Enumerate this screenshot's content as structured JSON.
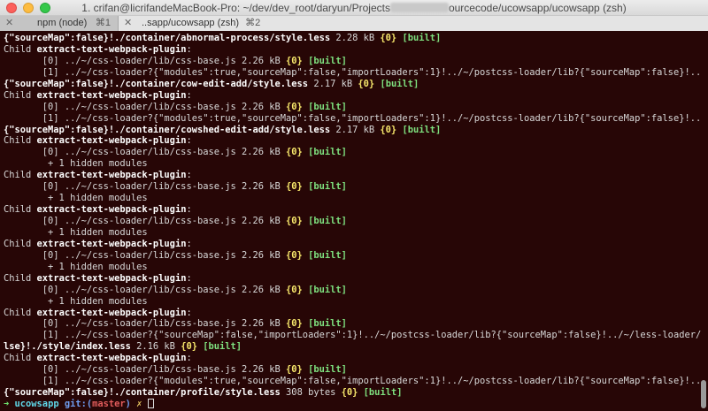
{
  "window": {
    "title_prefix": "1. crifan@licrifandeMacBook-Pro: ~/dev/dev_root/daryun/Projects",
    "title_suffix": "ourcecode/ucowsapp/ucowsapp (zsh)"
  },
  "tabs": [
    {
      "close": "✕",
      "label": "npm (node)",
      "shortcut": "⌘1"
    },
    {
      "close": "✕",
      "label": "..sapp/ucowsapp (zsh)",
      "shortcut": "⌘2"
    }
  ],
  "terminal": {
    "lines": [
      [
        [
          "b",
          "{\"sourceMap\":false}!./container/abnormal-process/style.less"
        ],
        [
          "d",
          " 2.28 kB "
        ],
        [
          "y",
          "{0}"
        ],
        [
          "d",
          " "
        ],
        [
          "g",
          "[built]"
        ]
      ],
      [
        [
          "d",
          "Child "
        ],
        [
          "b",
          "extract-text-webpack-plugin"
        ],
        [
          "d",
          ":"
        ]
      ],
      [
        [
          "d",
          "       [0] ../~/css-loader/lib/css-base.js 2.26 kB "
        ],
        [
          "y",
          "{0}"
        ],
        [
          "d",
          " "
        ],
        [
          "g",
          "[built]"
        ]
      ],
      [
        [
          "d",
          "       [1] ../~/css-loader?{\"modules\":true,\"sourceMap\":false,\"importLoaders\":1}!../~/postcss-loader/lib?{\"sourceMap\":false}!../~/less-loader/dist?"
        ]
      ],
      [
        [
          "b",
          "{\"sourceMap\":false}!./container/cow-edit-add/style.less"
        ],
        [
          "d",
          " 2.17 kB "
        ],
        [
          "y",
          "{0}"
        ],
        [
          "d",
          " "
        ],
        [
          "g",
          "[built]"
        ]
      ],
      [
        [
          "d",
          "Child "
        ],
        [
          "b",
          "extract-text-webpack-plugin"
        ],
        [
          "d",
          ":"
        ]
      ],
      [
        [
          "d",
          "       [0] ../~/css-loader/lib/css-base.js 2.26 kB "
        ],
        [
          "y",
          "{0}"
        ],
        [
          "d",
          " "
        ],
        [
          "g",
          "[built]"
        ]
      ],
      [
        [
          "d",
          "       [1] ../~/css-loader?{\"modules\":true,\"sourceMap\":false,\"importLoaders\":1}!../~/postcss-loader/lib?{\"sourceMap\":false}!../~/less-loader/dist?"
        ]
      ],
      [
        [
          "b",
          "{\"sourceMap\":false}!./container/cowshed-edit-add/style.less"
        ],
        [
          "d",
          " 2.17 kB "
        ],
        [
          "y",
          "{0}"
        ],
        [
          "d",
          " "
        ],
        [
          "g",
          "[built]"
        ]
      ],
      [
        [
          "d",
          "Child "
        ],
        [
          "b",
          "extract-text-webpack-plugin"
        ],
        [
          "d",
          ":"
        ]
      ],
      [
        [
          "d",
          "       [0] ../~/css-loader/lib/css-base.js 2.26 kB "
        ],
        [
          "y",
          "{0}"
        ],
        [
          "d",
          " "
        ],
        [
          "g",
          "[built]"
        ]
      ],
      [
        [
          "d",
          "        + 1 hidden modules"
        ]
      ],
      [
        [
          "d",
          "Child "
        ],
        [
          "b",
          "extract-text-webpack-plugin"
        ],
        [
          "d",
          ":"
        ]
      ],
      [
        [
          "d",
          "       [0] ../~/css-loader/lib/css-base.js 2.26 kB "
        ],
        [
          "y",
          "{0}"
        ],
        [
          "d",
          " "
        ],
        [
          "g",
          "[built]"
        ]
      ],
      [
        [
          "d",
          "        + 1 hidden modules"
        ]
      ],
      [
        [
          "d",
          "Child "
        ],
        [
          "b",
          "extract-text-webpack-plugin"
        ],
        [
          "d",
          ":"
        ]
      ],
      [
        [
          "d",
          "       [0] ../~/css-loader/lib/css-base.js 2.26 kB "
        ],
        [
          "y",
          "{0}"
        ],
        [
          "d",
          " "
        ],
        [
          "g",
          "[built]"
        ]
      ],
      [
        [
          "d",
          "        + 1 hidden modules"
        ]
      ],
      [
        [
          "d",
          "Child "
        ],
        [
          "b",
          "extract-text-webpack-plugin"
        ],
        [
          "d",
          ":"
        ]
      ],
      [
        [
          "d",
          "       [0] ../~/css-loader/lib/css-base.js 2.26 kB "
        ],
        [
          "y",
          "{0}"
        ],
        [
          "d",
          " "
        ],
        [
          "g",
          "[built]"
        ]
      ],
      [
        [
          "d",
          "        + 1 hidden modules"
        ]
      ],
      [
        [
          "d",
          "Child "
        ],
        [
          "b",
          "extract-text-webpack-plugin"
        ],
        [
          "d",
          ":"
        ]
      ],
      [
        [
          "d",
          "       [0] ../~/css-loader/lib/css-base.js 2.26 kB "
        ],
        [
          "y",
          "{0}"
        ],
        [
          "d",
          " "
        ],
        [
          "g",
          "[built]"
        ]
      ],
      [
        [
          "d",
          "        + 1 hidden modules"
        ]
      ],
      [
        [
          "d",
          "Child "
        ],
        [
          "b",
          "extract-text-webpack-plugin"
        ],
        [
          "d",
          ":"
        ]
      ],
      [
        [
          "d",
          "       [0] ../~/css-loader/lib/css-base.js 2.26 kB "
        ],
        [
          "y",
          "{0}"
        ],
        [
          "d",
          " "
        ],
        [
          "g",
          "[built]"
        ]
      ],
      [
        [
          "d",
          "       [1] ../~/css-loader?{\"sourceMap\":false,\"importLoaders\":1}!../~/postcss-loader/lib?{\"sourceMap\":false}!../~/less-loader/dist?{\"sourceMap\":fa"
        ]
      ],
      [
        [
          "b",
          "lse}!./style/index.less"
        ],
        [
          "d",
          " 2.16 kB "
        ],
        [
          "y",
          "{0}"
        ],
        [
          "d",
          " "
        ],
        [
          "g",
          "[built]"
        ]
      ],
      [
        [
          "d",
          "Child "
        ],
        [
          "b",
          "extract-text-webpack-plugin"
        ],
        [
          "d",
          ":"
        ]
      ],
      [
        [
          "d",
          "       [0] ../~/css-loader/lib/css-base.js 2.26 kB "
        ],
        [
          "y",
          "{0}"
        ],
        [
          "d",
          " "
        ],
        [
          "g",
          "[built]"
        ]
      ],
      [
        [
          "d",
          "       [1] ../~/css-loader?{\"modules\":true,\"sourceMap\":false,\"importLoaders\":1}!../~/postcss-loader/lib?{\"sourceMap\":false}!../~/less-loader/dist?"
        ]
      ],
      [
        [
          "b",
          "{\"sourceMap\":false}!./container/profile/style.less"
        ],
        [
          "d",
          " 308 bytes "
        ],
        [
          "y",
          "{0}"
        ],
        [
          "d",
          " "
        ],
        [
          "g",
          "[built]"
        ]
      ]
    ],
    "prompt": {
      "arrow": "➜",
      "dir": "ucowsapp",
      "git_label": "git:(",
      "branch": "master",
      "git_close": ")",
      "dirty": "✗"
    }
  }
}
